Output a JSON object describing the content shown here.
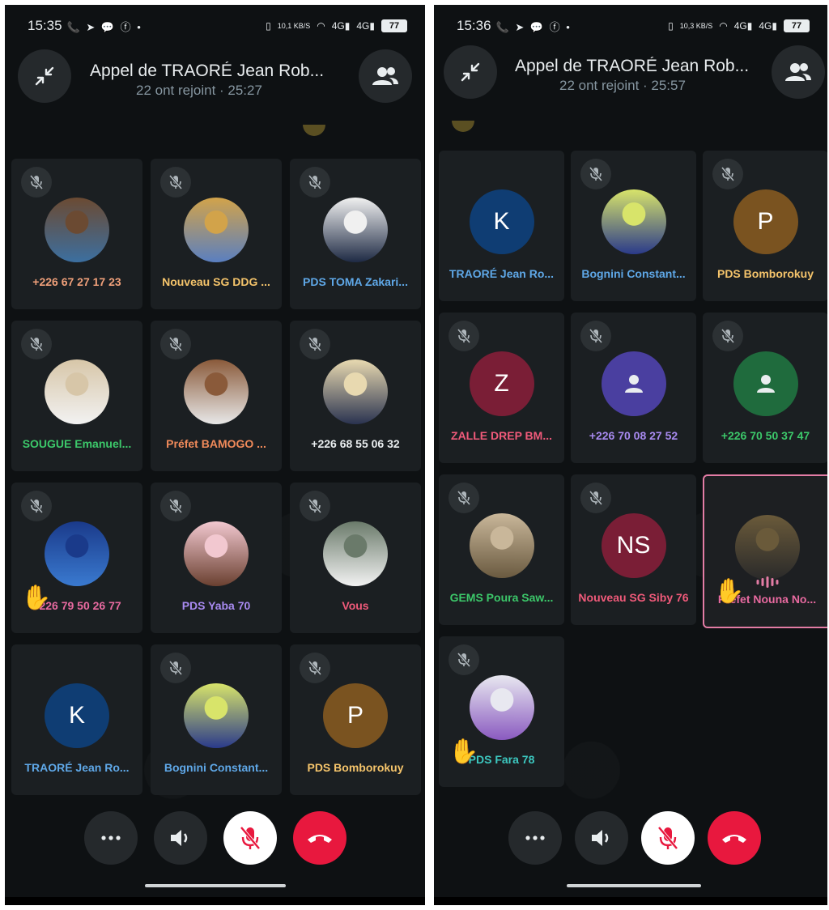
{
  "left": {
    "status": {
      "time": "15:35",
      "icons": "📞 ➤ 💬 ⓕ •",
      "net_speed": "10,1 KB/S",
      "battery": "77"
    },
    "header": {
      "title": "Appel de TRAORÉ Jean Rob...",
      "subtitle": "22 ont rejoint · 25:27"
    },
    "tiles": [
      {
        "name": "+226 67 27 17 23",
        "color": "#f0a07a",
        "avatar": "photo",
        "photo_colors": [
          "#6b4a32",
          "#3c6fa0"
        ]
      },
      {
        "name": "Nouveau SG DDG ...",
        "color": "#f5c46b",
        "avatar": "photo",
        "photo_colors": [
          "#d2a34a",
          "#5a7fc0"
        ]
      },
      {
        "name": "PDS TOMA Zakari...",
        "color": "#5fa8e8",
        "avatar": "photo",
        "photo_colors": [
          "#f0f0f0",
          "#1e2a44"
        ]
      },
      {
        "name": "SOUGUE Emanuel...",
        "color": "#3cc86a",
        "avatar": "photo",
        "photo_colors": [
          "#d7c6a8",
          "#f2f2f2"
        ]
      },
      {
        "name": "Préfet BAMOGO ...",
        "color": "#f08a5a",
        "avatar": "photo",
        "photo_colors": [
          "#8a5a3a",
          "#e8e8e8"
        ]
      },
      {
        "name": "+226 68 55 06 32",
        "color": "#e9edef",
        "avatar": "photo",
        "photo_colors": [
          "#e8d9b0",
          "#2a3350"
        ]
      },
      {
        "name": "+226 79 50 26 77",
        "color": "#e86aa0",
        "avatar": "photo",
        "photo_colors": [
          "#1a3a8a",
          "#3a7ad0"
        ],
        "hand": true
      },
      {
        "name": "PDS Yaba 70",
        "color": "#a88af0",
        "avatar": "photo",
        "photo_colors": [
          "#f2c8d0",
          "#6a4030"
        ]
      },
      {
        "name": "Vous",
        "color": "#f05a7a",
        "avatar": "photo",
        "photo_colors": [
          "#6a7a6a",
          "#f2f2f2"
        ]
      },
      {
        "name": "TRAORÉ Jean Ro...",
        "color": "#5fa8e8",
        "avatar": "letter",
        "letter": "K",
        "bg": "#0f3d73",
        "no_mute": true
      },
      {
        "name": "Bognini Constant...",
        "color": "#5fa8e8",
        "avatar": "photo",
        "photo_colors": [
          "#d8e46a",
          "#2a3a8a"
        ]
      },
      {
        "name": "PDS Bomborokuy",
        "color": "#f5c46b",
        "avatar": "letter",
        "letter": "P",
        "bg": "#7a5320"
      }
    ]
  },
  "right": {
    "status": {
      "time": "15:36",
      "icons": "📞 ➤ 💬 ⓕ •",
      "net_speed": "10,3 KB/S",
      "battery": "77"
    },
    "header": {
      "title": "Appel de TRAORÉ Jean Rob...",
      "subtitle": "22 ont rejoint · 25:57"
    },
    "tiles": [
      {
        "name": "TRAORÉ Jean Ro...",
        "color": "#5fa8e8",
        "avatar": "letter",
        "letter": "K",
        "bg": "#0f3d73",
        "no_mute": true
      },
      {
        "name": "Bognini Constant...",
        "color": "#5fa8e8",
        "avatar": "photo",
        "photo_colors": [
          "#d8e46a",
          "#2a3a8a"
        ]
      },
      {
        "name": "PDS Bomborokuy",
        "color": "#f5c46b",
        "avatar": "letter",
        "letter": "P",
        "bg": "#7a5320"
      },
      {
        "name": "ZALLE DREP BM...",
        "color": "#f05a7a",
        "avatar": "letter",
        "letter": "Z",
        "bg": "#7a1e36"
      },
      {
        "name": "+226 70 08 27 52",
        "color": "#a88af0",
        "avatar": "person",
        "bg": "#4a3fa0"
      },
      {
        "name": "+226 70 50 37 47",
        "color": "#3cc86a",
        "avatar": "person",
        "bg": "#1f6b3d"
      },
      {
        "name": "GEMS Poura Saw...",
        "color": "#3cc86a",
        "avatar": "photo",
        "photo_colors": [
          "#c9b79a",
          "#6a5a40"
        ]
      },
      {
        "name": "Nouveau SG Siby 76",
        "color": "#f05a7a",
        "avatar": "letter",
        "letter": "NS",
        "bg": "#7a1e36"
      },
      {
        "name": "Préfet Nouna No...",
        "color": "#e86aa0",
        "avatar": "photo",
        "photo_colors": [
          "#6a5a3a",
          "#2a2a2a"
        ],
        "hand": true,
        "speaking": true,
        "no_mute": true
      },
      {
        "name": "PDS Fara 78",
        "color": "#3cc8c0",
        "avatar": "photo",
        "photo_colors": [
          "#e8e8f0",
          "#8a5ac0"
        ],
        "hand": true
      }
    ]
  },
  "icons": {
    "minimize": "minimize-icon",
    "participants": "participants-icon",
    "more": "more-icon",
    "speaker": "speaker-icon",
    "mic_off": "mic-off-icon",
    "end_call": "end-call-icon",
    "raised_hand": "raised-hand-icon"
  },
  "colors": {
    "end_call": "#e8183e",
    "mic_button_bg": "#ffffff",
    "mic_off_icon": "#e8183e",
    "speaking_border": "#e37ca5"
  }
}
